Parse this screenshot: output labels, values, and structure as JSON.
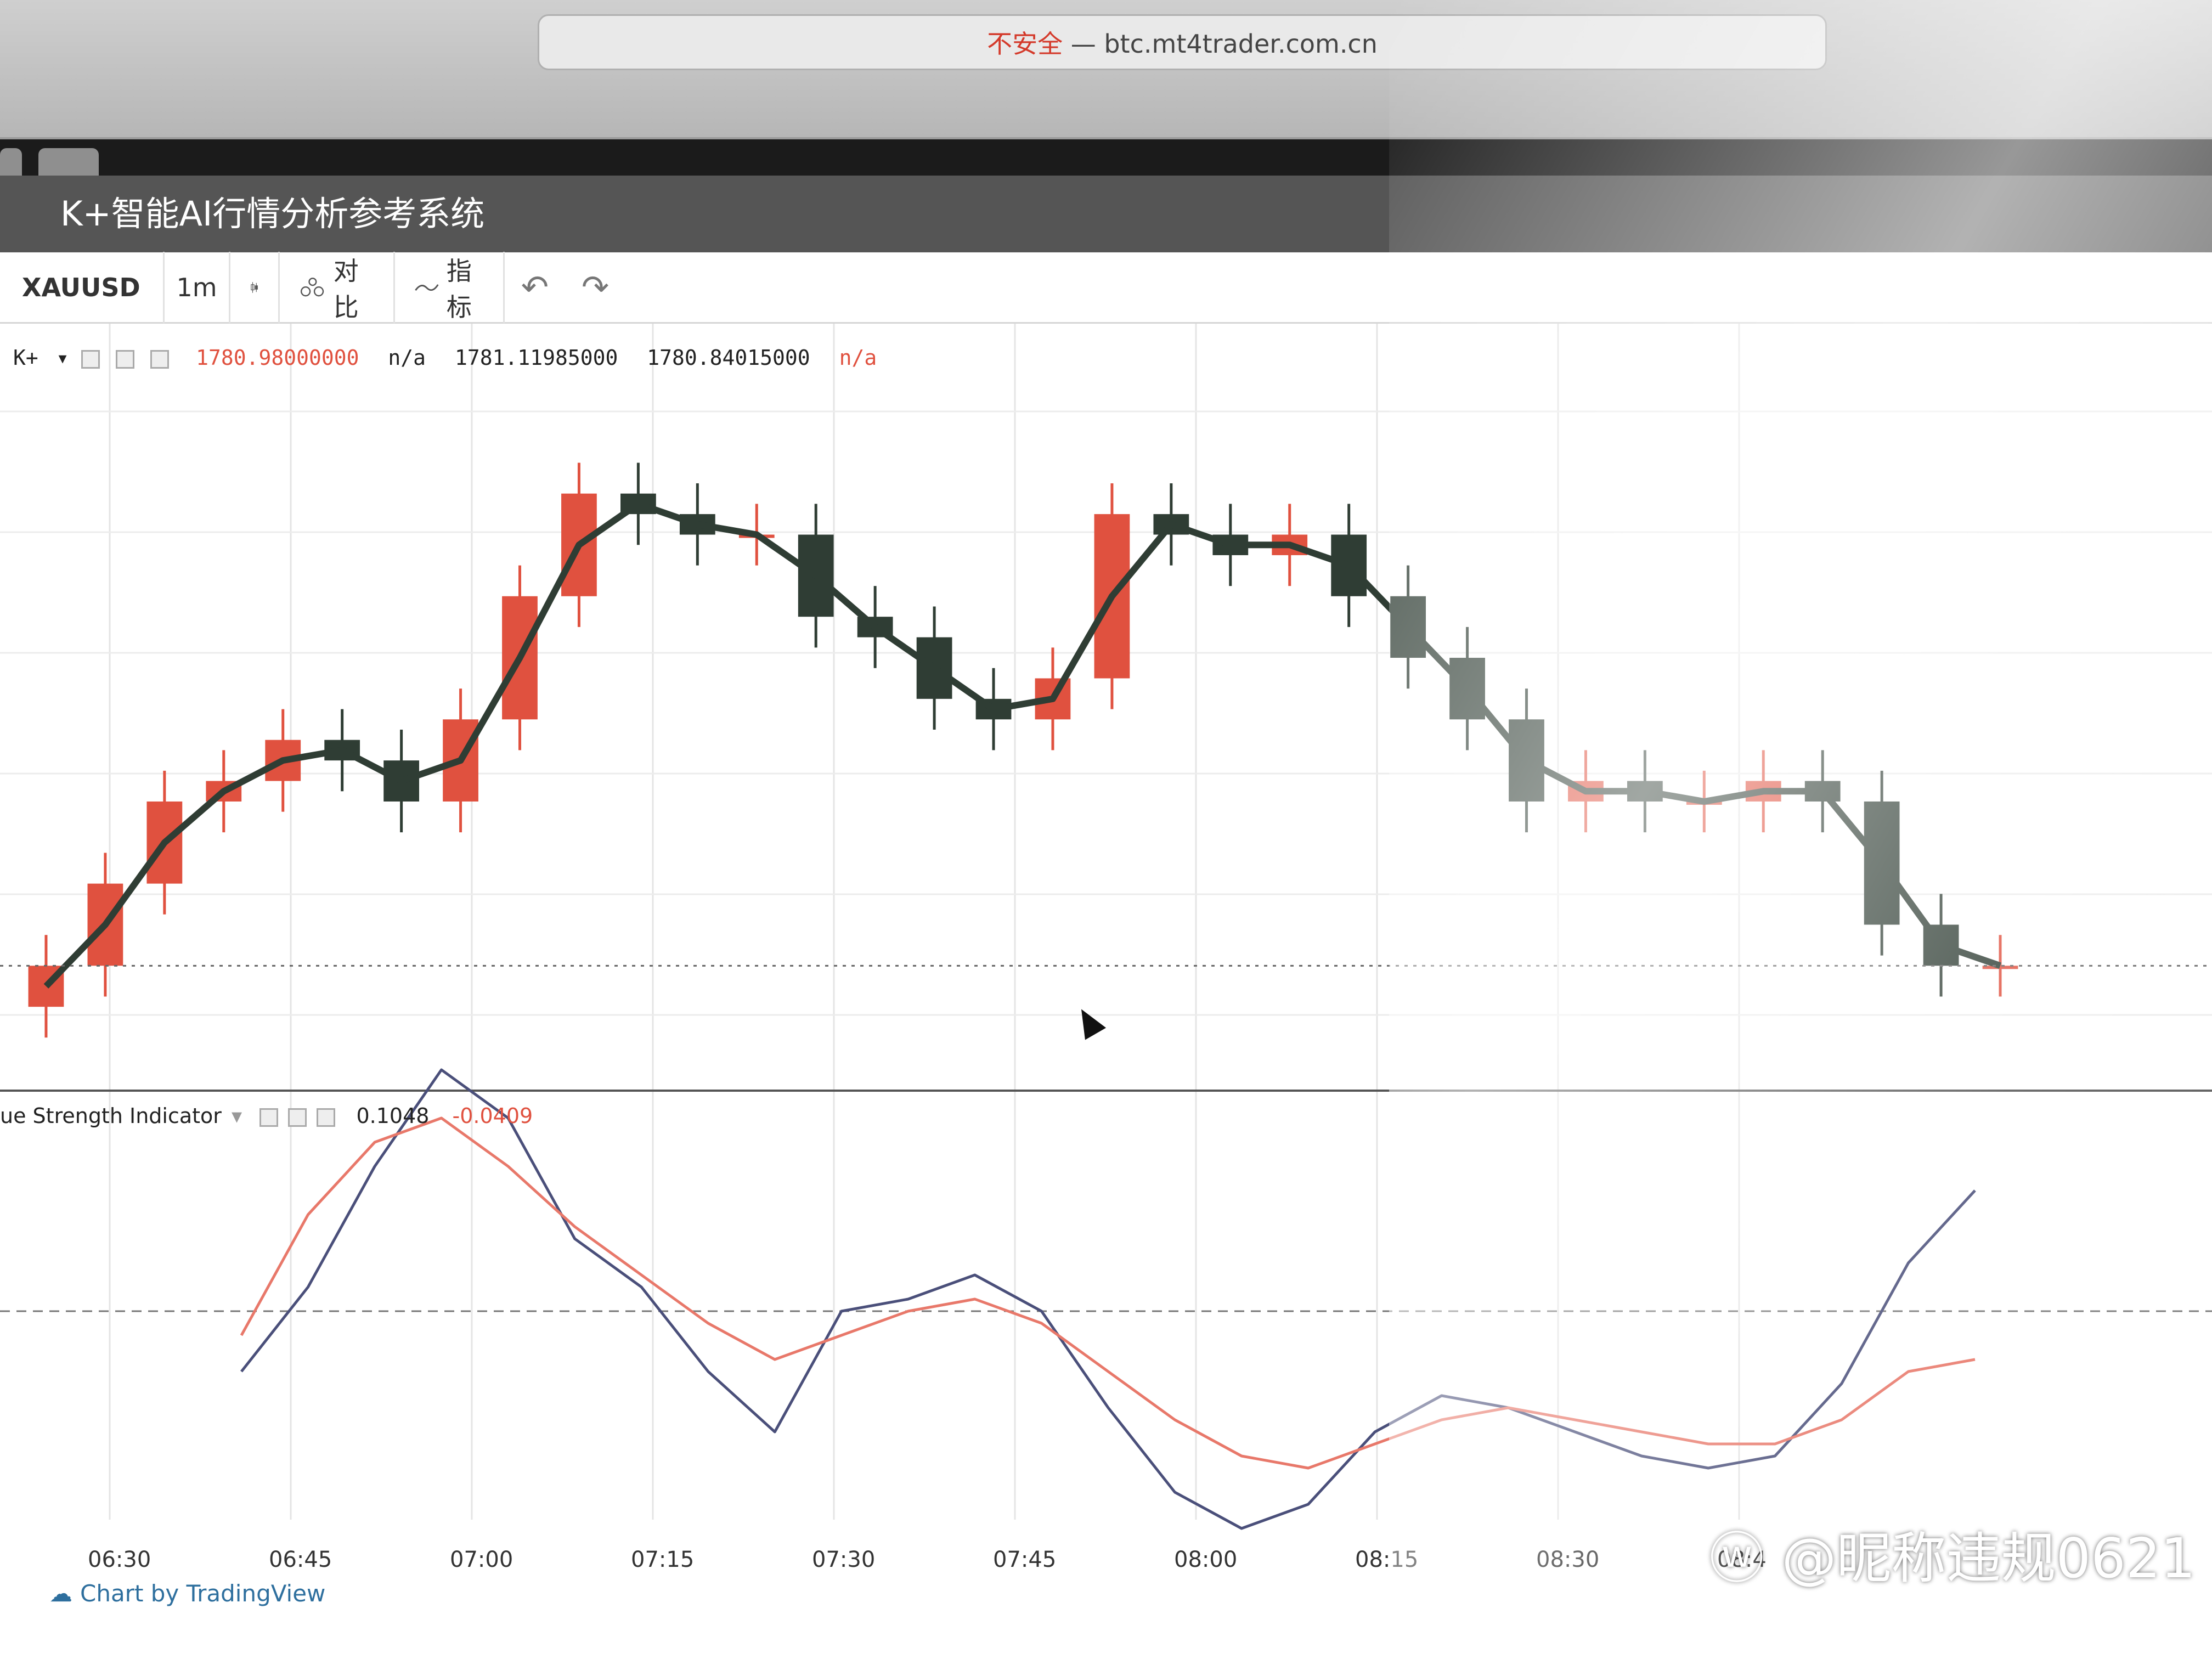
{
  "browser": {
    "insecure_label": "不安全",
    "separator": " — ",
    "url": "btc.mt4trader.com.cn"
  },
  "app": {
    "title": "K+智能AI行情分析参考系统"
  },
  "toolbar": {
    "symbol": "XAUUSD",
    "interval": "1m",
    "compare_label": "对比",
    "indicators_label": "指标"
  },
  "main_legend": {
    "study_name": "K+",
    "value_1": "1780.98000000",
    "value_2": "n/a",
    "value_3": "1781.11985000",
    "value_4": "1780.84015000",
    "value_5": "n/a"
  },
  "indicator_legend": {
    "name": "ue Strength Indicator",
    "value_main": "0.1048",
    "value_signal": "-0.0409"
  },
  "watermark": {
    "tradingview": "Chart by TradingView",
    "weibo": "@昵称违规0621"
  },
  "time_axis": [
    "06:30",
    "06:45",
    "07:00",
    "07:15",
    "07:30",
    "07:45",
    "08:00",
    "08:15",
    "08:30",
    "08:4"
  ],
  "colors": {
    "bull": "#e0513f",
    "bear": "#2f3d34",
    "signal_line": "#e8786a",
    "main_line": "#4a4f7a"
  },
  "chart_data": [
    {
      "type": "candlestick",
      "series": [
        {
          "name": "XAUUSD 1m",
          "close": [
            1779.2,
            1779.6,
            1780.0,
            1780.1,
            1780.3,
            1780.2,
            1780.0,
            1780.4,
            1781.0,
            1781.5,
            1781.4,
            1781.3,
            1781.3,
            1780.9,
            1780.8,
            1780.5,
            1780.4,
            1780.6,
            1781.4,
            1781.3,
            1781.2,
            1781.3,
            1781.0,
            1780.7,
            1780.4,
            1780.0,
            1780.1,
            1780.0,
            1780.0,
            1780.1,
            1780.0,
            1779.4,
            1779.2,
            1779.2
          ]
        }
      ]
    },
    {
      "type": "line",
      "series": [
        {
          "name": "",
          "values": [
            -0.05,
            0.02,
            0.12,
            0.2,
            0.16,
            0.06,
            0.02,
            -0.05,
            -0.1,
            0.0,
            0.01,
            0.03,
            0.0,
            -0.08,
            -0.15,
            -0.18,
            -0.16,
            -0.1,
            -0.07,
            -0.08,
            -0.1,
            -0.12,
            -0.13,
            -0.12,
            -0.06,
            0.04,
            0.1
          ]
        },
        {
          "name": "",
          "values": [
            -0.02,
            0.08,
            0.14,
            0.16,
            0.12,
            0.07,
            0.03,
            -0.01,
            -0.04,
            -0.02,
            0.0,
            0.01,
            -0.01,
            -0.05,
            -0.09,
            -0.12,
            -0.13,
            -0.11,
            -0.09,
            -0.08,
            -0.09,
            -0.1,
            -0.11,
            -0.11,
            -0.09,
            -0.05,
            -0.04
          ]
        }
      ]
    }
  ]
}
